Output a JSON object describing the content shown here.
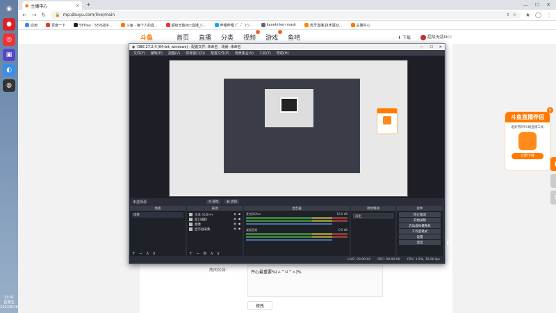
{
  "taskbar": {
    "clock_time": "13:01",
    "clock_day": "星期五",
    "clock_date": "2022/8/26"
  },
  "browser": {
    "tab_title": "主播中心",
    "url": "mp.douyu.com/live/main",
    "bookmarks": [
      {
        "label": "应用",
        "color": "#4285f4"
      },
      {
        "label": "百度一下",
        "color": "#e33"
      },
      {
        "label": "5EPlay - 5E对战平...",
        "color": "#222"
      },
      {
        "label": "斗鱼 - 每个人的直...",
        "color": "#ff7a00"
      },
      {
        "label": "超级无敌Ncc直播_C...",
        "color": "#e33"
      },
      {
        "label": "哔哩哔哩 (゜-゜)つ...",
        "color": "#0af"
      },
      {
        "label": "kaneki-ken mask",
        "color": "#666"
      },
      {
        "label": "虎牙直播-技术驱动...",
        "color": "#f80"
      },
      {
        "label": "主播中心",
        "color": "#ff7a00"
      }
    ]
  },
  "douyu": {
    "logo": "斗鱼",
    "nav": [
      "首页",
      "直播",
      "分类",
      "视频",
      "游戏",
      "鱼吧"
    ],
    "download": "下载",
    "username": "超级无敌Ncc"
  },
  "obs": {
    "title": "OBS 27.2.4 (64-bit, windows) - 配置文件: 未命名 - 场景: 未命名",
    "menu": [
      "文件(F)",
      "编辑(E)",
      "视图(V)",
      "停靠窗口(D)",
      "配置文件(P)",
      "场景集合(S)",
      "工具(T)",
      "帮助(H)"
    ],
    "no_source": "未选择源",
    "props_btn": "属性",
    "filters_btn": "滤镜",
    "docks": {
      "scenes": "场景",
      "sources": "来源",
      "mixer": "混音器",
      "transitions": "转场特效",
      "controls": "控件"
    },
    "scene_item": "场景",
    "sources": [
      "文本 (GDI+)",
      "窗口捕获",
      "图像",
      "显示器采集"
    ],
    "mixer": [
      {
        "name": "麦克风/Aux",
        "db": "-12.0 dB"
      },
      {
        "name": "桌面音频",
        "db": "0.0 dB"
      }
    ],
    "transition": "淡出",
    "controls": [
      "停止推流",
      "开始录制",
      "启动虚拟摄像机",
      "工作室模式",
      "设置",
      "退出"
    ],
    "status": {
      "live": "LIVE: 00:00:00",
      "rec": "REC: 00:00:00",
      "cpu": "CPU: 1.9%, 30.00 fps"
    }
  },
  "page": {
    "notice_label": "房间公告：",
    "notice_text": "开心最重要%(ㅅ^ㅁ^ㅅ)%",
    "modify_btn": "修改"
  },
  "promo": {
    "title": "斗鱼直播伴侣",
    "subtitle": "超好用的PC端直播工具",
    "btn": "立即下载",
    "close": "×"
  }
}
